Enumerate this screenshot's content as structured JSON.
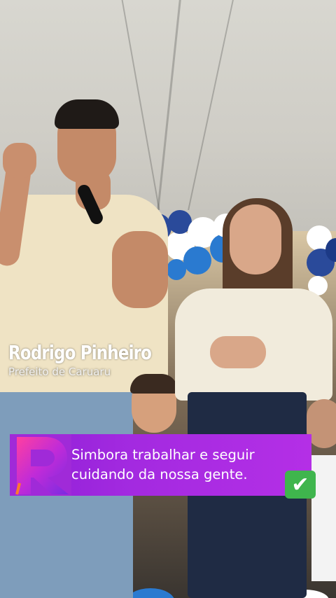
{
  "overlay": {
    "name": "Rodrigo Pinheiro",
    "role": "Prefeito de Caruaru",
    "caption": "Simbora trabalhar e seguir\ncuidando da nossa gente.",
    "caption_emoji": "✔",
    "colors": {
      "banner": "#a32ae0",
      "check": "#3fb54d"
    }
  }
}
